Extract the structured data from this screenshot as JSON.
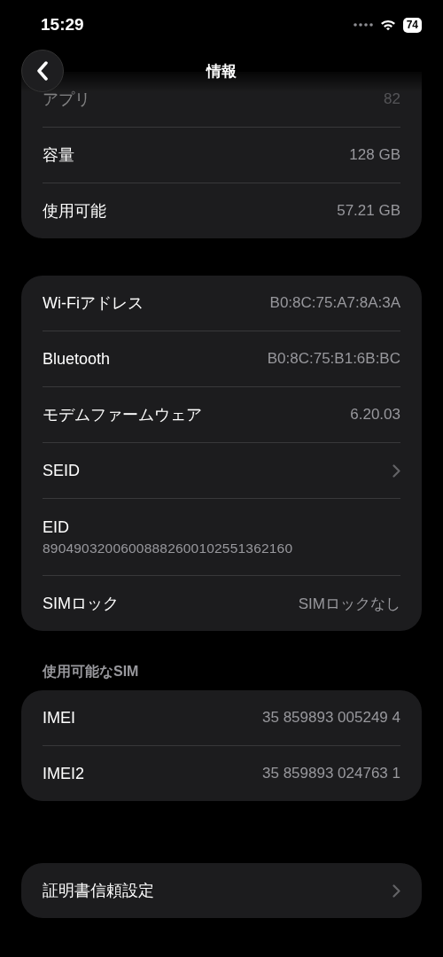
{
  "status_bar": {
    "time": "15:29",
    "battery": "74"
  },
  "nav": {
    "title": "情報"
  },
  "groups": [
    {
      "rows": [
        {
          "label": "アプリ",
          "value": "82",
          "kind": "value",
          "dimmed": true
        },
        {
          "label": "容量",
          "value": "128 GB",
          "kind": "value",
          "dimmed": false
        },
        {
          "label": "使用可能",
          "value": "57.21 GB",
          "kind": "value",
          "dimmed": false
        }
      ]
    },
    {
      "rows": [
        {
          "label": "Wi-Fiアドレス",
          "value": "B0:8C:75:A7:8A:3A",
          "kind": "value",
          "dimmed": false
        },
        {
          "label": "Bluetooth",
          "value": "B0:8C:75:B1:6B:BC",
          "kind": "value",
          "dimmed": false
        },
        {
          "label": "モデムファームウェア",
          "value": "6.20.03",
          "kind": "value",
          "dimmed": false
        },
        {
          "label": "SEID",
          "kind": "link",
          "dimmed": false
        },
        {
          "label": "EID",
          "value": "89049032006008882600102551362160",
          "kind": "stacked",
          "dimmed": false
        },
        {
          "label": "SIMロック",
          "value": "SIMロックなし",
          "kind": "value",
          "dimmed": false
        }
      ]
    },
    {
      "header": "使用可能なSIM",
      "rows": [
        {
          "label": "IMEI",
          "value": "35 859893 005249 4",
          "kind": "value",
          "dimmed": false
        },
        {
          "label": "IMEI2",
          "value": "35 859893 024763 1",
          "kind": "value",
          "dimmed": false
        }
      ]
    },
    {
      "rows": [
        {
          "label": "証明書信頼設定",
          "kind": "link",
          "dimmed": false
        }
      ]
    }
  ]
}
